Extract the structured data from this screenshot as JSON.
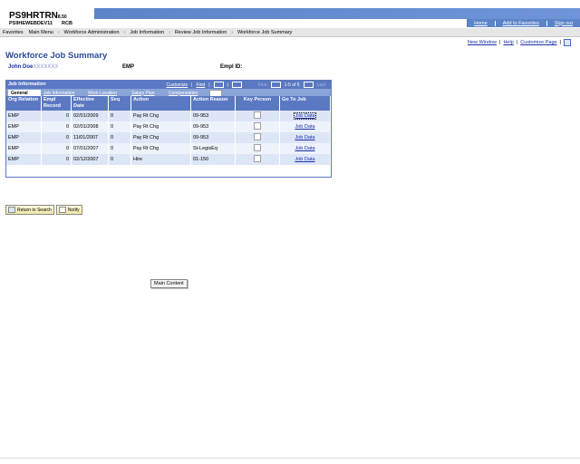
{
  "header": {
    "system": "PS9HRTRN",
    "version": "8.50",
    "server": "PS9HEWEBDEV11",
    "code": "RCB",
    "links": [
      "Home",
      "Add to Favorites",
      "Sign out"
    ]
  },
  "breadcrumb": [
    "Favorites",
    "Main Menu",
    "Workforce Administration",
    "Job Information",
    "Review Job Information",
    "Workforce Job Summary"
  ],
  "page_links": [
    "New Window",
    "Help",
    "Customize Page"
  ],
  "page_title": "Workforce Job Summary",
  "employee": {
    "name": "John Doe",
    "name_suffix": "XXXXXXX",
    "type": "EMP",
    "emplid_label": "Empl ID:"
  },
  "grid": {
    "title": "Job Information",
    "customize": "Customize",
    "find": "Find",
    "first": "First",
    "range": "1-5 of 5",
    "last": "Last",
    "tabs": [
      "General",
      "Job Information",
      "Work Location",
      "Salary Plan",
      "Compensation"
    ],
    "columns": [
      "Org Relation",
      "Empl Record",
      "Effective Date",
      "Seq",
      "Action",
      "Action Reason",
      "Key Person",
      "Go To Job"
    ],
    "rows": [
      {
        "org": "EMP",
        "rec": "0",
        "date": "02/01/2009",
        "seq": "0",
        "action": "Pay Rt Chg",
        "reason": "09-953",
        "link": "Job Data"
      },
      {
        "org": "EMP",
        "rec": "0",
        "date": "02/01/2008",
        "seq": "0",
        "action": "Pay Rt Chg",
        "reason": "09-953",
        "link": "Job Data"
      },
      {
        "org": "EMP",
        "rec": "0",
        "date": "11/01/2007",
        "seq": "0",
        "action": "Pay Rt Chg",
        "reason": "09-953",
        "link": "Job Data"
      },
      {
        "org": "EMP",
        "rec": "0",
        "date": "07/01/2007",
        "seq": "0",
        "action": "Pay Rt Chg",
        "reason": "St-LegisEq",
        "link": "Job Data"
      },
      {
        "org": "EMP",
        "rec": "0",
        "date": "02/12/2007",
        "seq": "0",
        "action": "Hire",
        "reason": "01-150",
        "link": "Job Data"
      }
    ]
  },
  "buttons": {
    "return": "Return to Search",
    "notify": "Notify"
  },
  "main_content": "Main Content",
  "colors": {
    "accent": "#5b79c2",
    "link": "#1a2fa8",
    "title": "#2b4a9a"
  }
}
